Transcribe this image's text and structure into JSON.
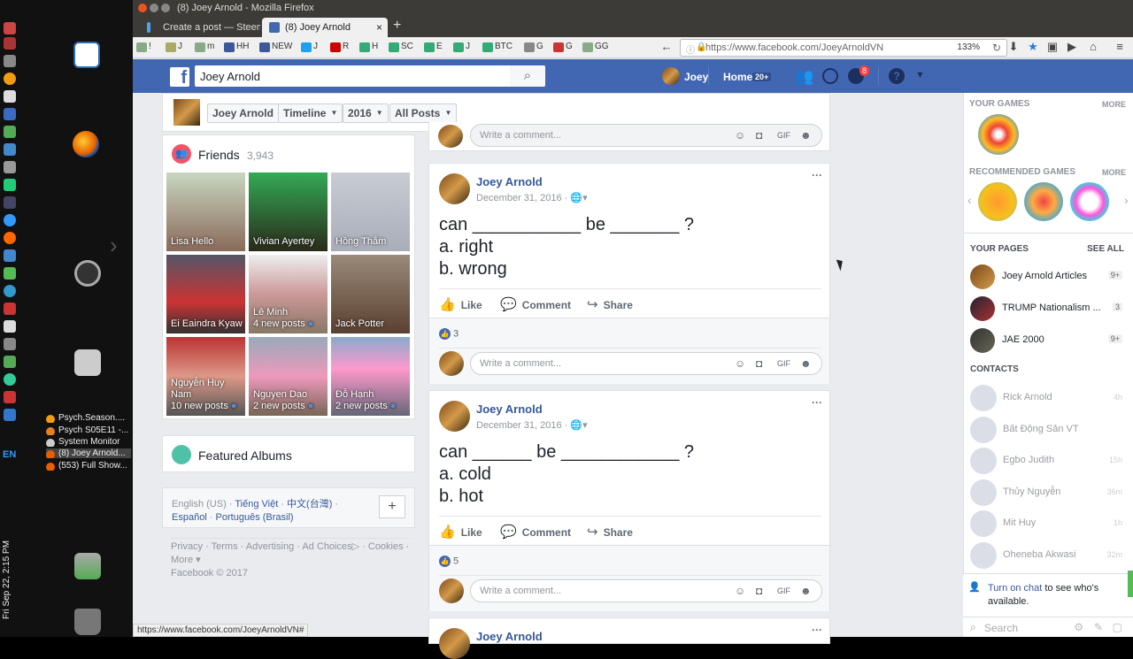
{
  "taskbar": {
    "lang": "EN",
    "tray_tasks": [
      {
        "label": "Psych.Season....",
        "color": "#f39c12"
      },
      {
        "label": "Psych S05E11 -...",
        "color": "#e67e22"
      },
      {
        "label": "System Monitor",
        "color": "#ccc"
      },
      {
        "label": "(8) Joey Arnold...",
        "color": "#e66000"
      },
      {
        "label": "(553) Full Show...",
        "color": "#e66000"
      }
    ],
    "clock": "Fri Sep 22, 2:15 PM"
  },
  "window": {
    "title": "(8) Joey Arnold - Mozilla Firefox",
    "tabs": [
      {
        "label": "Create a post — Steem",
        "active": false
      },
      {
        "label": "(8) Joey Arnold",
        "active": true
      }
    ],
    "bookmarks": [
      "!",
      "J",
      "m",
      "HH",
      "NEW",
      "J",
      "R",
      "H",
      "SC",
      "E",
      "J",
      "BTC",
      "G",
      "G",
      "GG"
    ],
    "url": "https://www.facebook.com/JoeyArnoldVN",
    "zoom": "133%",
    "status_url": "https://www.facebook.com/JoeyArnoldVN#"
  },
  "fb": {
    "search_value": "Joey Arnold",
    "profile_name": "Joey",
    "home_label": "Home",
    "home_badge": "20+",
    "notif_badge": "8"
  },
  "page_header": {
    "name": "Joey Arnold",
    "timeline": "Timeline",
    "year": "2016",
    "filter": "All Posts"
  },
  "friends": {
    "title": "Friends",
    "count": "3,943",
    "items": [
      {
        "name": "Lisa Hello",
        "sub": ""
      },
      {
        "name": "Vivian Ayertey",
        "sub": ""
      },
      {
        "name": "Hồng Thắm",
        "sub": ""
      },
      {
        "name": "Ei Eaindra Kyaw",
        "sub": ""
      },
      {
        "name": "Lê Minh",
        "sub": "4 new posts"
      },
      {
        "name": "Jack Potter",
        "sub": ""
      },
      {
        "name": "Nguyễn Huy Nam",
        "sub": "10 new posts"
      },
      {
        "name": "Nguyen Dao",
        "sub": "2 new posts"
      },
      {
        "name": "Đỗ Hạnh",
        "sub": "2 new posts"
      }
    ]
  },
  "featured": {
    "title": "Featured Albums"
  },
  "languages": {
    "current": "English (US)",
    "links": [
      "Tiếng Việt",
      "中文(台灣)",
      "Español",
      "Português (Brasil)"
    ],
    "add": "+"
  },
  "footer": {
    "links": [
      "Privacy",
      "Terms",
      "Advertising",
      "Ad Choices",
      "Cookies",
      "More"
    ],
    "copyright": "Facebook © 2017"
  },
  "comment_placeholder": "Write a comment...",
  "actions": {
    "like": "Like",
    "comment": "Comment",
    "share": "Share"
  },
  "posts": [
    {
      "author": "Joey Arnold",
      "date": "December 31, 2016",
      "body": "can ___________ be _______ ?\na. right\nb. wrong",
      "likes": "3"
    },
    {
      "author": "Joey Arnold",
      "date": "December 31, 2016",
      "body": "can ______ be ____________ ?\na. cold\nb. hot",
      "likes": "5"
    },
    {
      "author": "Joey Arnold"
    }
  ],
  "right": {
    "your_games": "YOUR GAMES",
    "more": "MORE",
    "recommended_games": "RECOMMENDED GAMES",
    "your_pages": "YOUR PAGES",
    "see_all": "SEE ALL",
    "pages": [
      {
        "name": "Joey Arnold Articles",
        "count": "9+"
      },
      {
        "name": "TRUMP Nationalism ...",
        "count": "3"
      },
      {
        "name": "JAE 2000",
        "count": "9+"
      }
    ],
    "contacts_title": "CONTACTS",
    "contacts": [
      {
        "name": "Rick Arnold",
        "time": "4h"
      },
      {
        "name": "Bất Động Sản VT",
        "time": ""
      },
      {
        "name": "Egbo Judith",
        "time": "15h"
      },
      {
        "name": "Thủy Nguyễn",
        "time": "36m"
      },
      {
        "name": "Mit Huy",
        "time": "1h"
      },
      {
        "name": "Oheneba Akwasi",
        "time": "32m"
      }
    ],
    "chat_link": "Turn on chat",
    "chat_text": " to see who's available.",
    "search_placeholder": "Search"
  }
}
